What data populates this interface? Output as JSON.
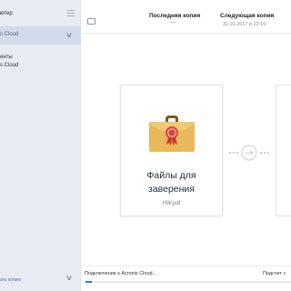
{
  "sidebar": {
    "title": "ютер",
    "selected": "s Cloud",
    "items": [
      "енты",
      "s Cloud"
    ],
    "footer": "ать копию"
  },
  "header": {
    "last_copy_label": "Последняя копия",
    "last_copy_value": "—",
    "next_copy_label": "Следующая копия",
    "next_copy_value": "31.01.2017 в 22:16"
  },
  "card": {
    "title_line1": "Файлы для",
    "title_line2": "заверения",
    "file": "HW.pdf",
    "icon": "briefcase-certificate-icon"
  },
  "status": {
    "left": "Подключение к Acronis Cloud...",
    "right": "Подсчет с",
    "progress": 0.03
  },
  "colors": {
    "sidebar_bg": "#e6ebf4",
    "accent": "#2f7bc9",
    "briefcase": "#e8b95b",
    "seal": "#d9473a"
  }
}
